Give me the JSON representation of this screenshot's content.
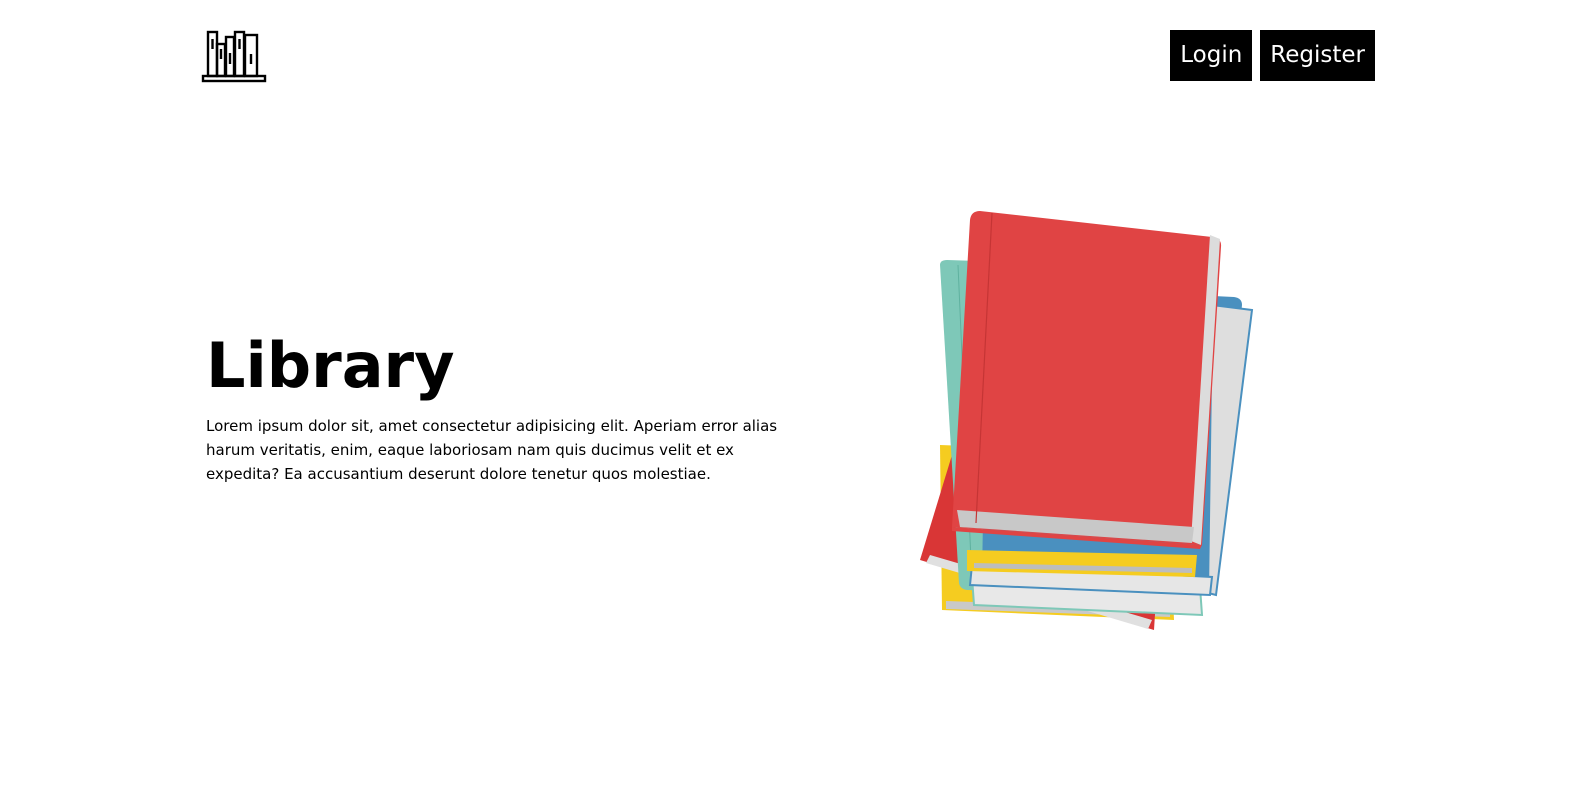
{
  "header": {
    "logo_icon": "bookshelf-icon",
    "login_label": "Login",
    "register_label": "Register"
  },
  "hero": {
    "title": "Library",
    "description": "Lorem ipsum dolor sit, amet consectetur adipisicing elit. Aperiam error alias harum veritatis, enim, eaque laboriosam nam quis ducimus velit et ex expedita? Ea accusantium deserunt dolore tenetur quos molestiae."
  },
  "illustration": {
    "icon": "book-stack-illustration",
    "colors": {
      "red": "#e04444",
      "teal": "#7ec8b8",
      "blue": "#4a90bf",
      "yellow": "#f5cc20",
      "gray": "#888888",
      "pages": "#d8d8d8"
    }
  },
  "colors": {
    "background": "#ffffff",
    "button_bg": "#000000",
    "button_text": "#ffffff",
    "text": "#000000"
  }
}
